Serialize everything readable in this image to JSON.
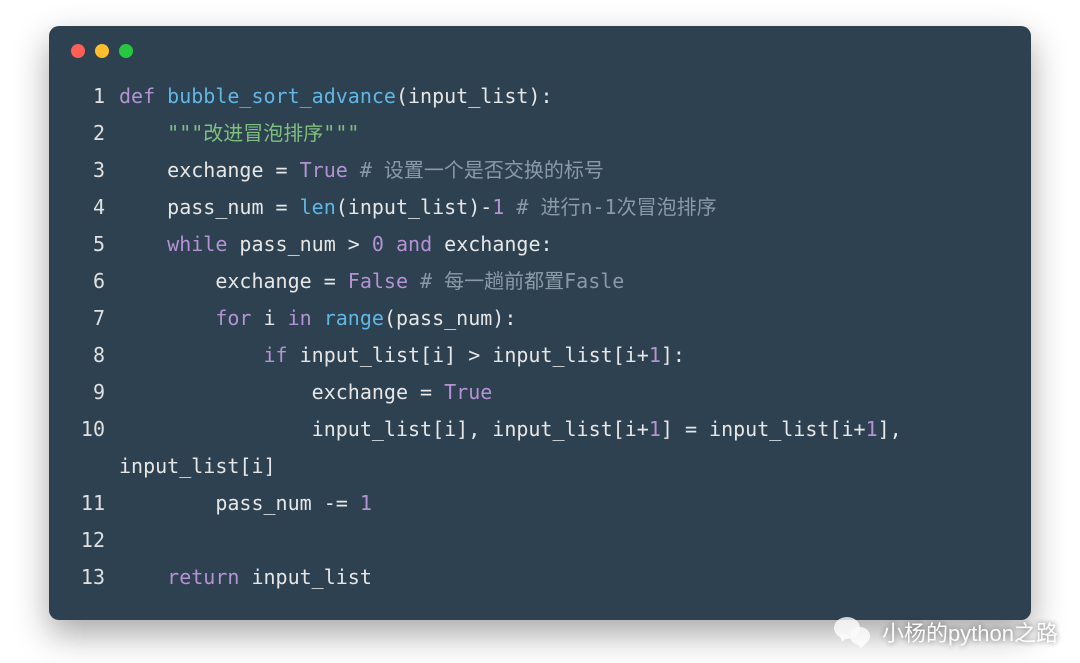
{
  "window": {
    "traffic": [
      "red",
      "yellow",
      "green"
    ]
  },
  "watermark": {
    "text": "小杨的python之路"
  },
  "code": {
    "lines": [
      {
        "n": "1",
        "tokens": [
          {
            "c": "kw",
            "t": "def "
          },
          {
            "c": "fn",
            "t": "bubble_sort_advance"
          },
          {
            "c": "id",
            "t": "(input_list):"
          }
        ]
      },
      {
        "n": "2",
        "tokens": [
          {
            "c": "id",
            "t": "    "
          },
          {
            "c": "str",
            "t": "\"\"\"改进冒泡排序\"\"\""
          }
        ]
      },
      {
        "n": "3",
        "tokens": [
          {
            "c": "id",
            "t": "    exchange = "
          },
          {
            "c": "const",
            "t": "True"
          },
          {
            "c": "id",
            "t": " "
          },
          {
            "c": "cmt",
            "t": "# 设置一个是否交换的标号"
          }
        ]
      },
      {
        "n": "4",
        "tokens": [
          {
            "c": "id",
            "t": "    pass_num = "
          },
          {
            "c": "fn",
            "t": "len"
          },
          {
            "c": "id",
            "t": "(input_list)-"
          },
          {
            "c": "num",
            "t": "1"
          },
          {
            "c": "id",
            "t": " "
          },
          {
            "c": "cmt",
            "t": "# 进行n-1次冒泡排序"
          }
        ]
      },
      {
        "n": "5",
        "tokens": [
          {
            "c": "id",
            "t": "    "
          },
          {
            "c": "kw",
            "t": "while"
          },
          {
            "c": "id",
            "t": " pass_num > "
          },
          {
            "c": "num",
            "t": "0"
          },
          {
            "c": "id",
            "t": " "
          },
          {
            "c": "kw",
            "t": "and"
          },
          {
            "c": "id",
            "t": " exchange:"
          }
        ]
      },
      {
        "n": "6",
        "tokens": [
          {
            "c": "id",
            "t": "        exchange = "
          },
          {
            "c": "const",
            "t": "False"
          },
          {
            "c": "id",
            "t": " "
          },
          {
            "c": "cmt",
            "t": "# 每一趟前都置Fasle"
          }
        ]
      },
      {
        "n": "7",
        "tokens": [
          {
            "c": "id",
            "t": "        "
          },
          {
            "c": "kw",
            "t": "for"
          },
          {
            "c": "id",
            "t": " i "
          },
          {
            "c": "kw",
            "t": "in"
          },
          {
            "c": "id",
            "t": " "
          },
          {
            "c": "fn",
            "t": "range"
          },
          {
            "c": "id",
            "t": "(pass_num):"
          }
        ]
      },
      {
        "n": "8",
        "tokens": [
          {
            "c": "id",
            "t": "            "
          },
          {
            "c": "kw",
            "t": "if"
          },
          {
            "c": "id",
            "t": " input_list[i] > input_list[i+"
          },
          {
            "c": "num",
            "t": "1"
          },
          {
            "c": "id",
            "t": "]:"
          }
        ]
      },
      {
        "n": "9",
        "tokens": [
          {
            "c": "id",
            "t": "                exchange = "
          },
          {
            "c": "const",
            "t": "True"
          }
        ]
      },
      {
        "n": "10",
        "tokens": [
          {
            "c": "id",
            "t": "                input_list[i], input_list[i+"
          },
          {
            "c": "num",
            "t": "1"
          },
          {
            "c": "id",
            "t": "] = input_list[i+"
          },
          {
            "c": "num",
            "t": "1"
          },
          {
            "c": "id",
            "t": "],"
          }
        ]
      },
      {
        "n": "",
        "tokens": [
          {
            "c": "id",
            "t": "input_list[i]"
          }
        ],
        "continuation": true
      },
      {
        "n": "11",
        "tokens": [
          {
            "c": "id",
            "t": "        pass_num -= "
          },
          {
            "c": "num",
            "t": "1"
          }
        ]
      },
      {
        "n": "12",
        "tokens": [
          {
            "c": "id",
            "t": ""
          }
        ]
      },
      {
        "n": "13",
        "tokens": [
          {
            "c": "id",
            "t": "    "
          },
          {
            "c": "kw",
            "t": "return"
          },
          {
            "c": "id",
            "t": " input_list"
          }
        ]
      }
    ]
  }
}
